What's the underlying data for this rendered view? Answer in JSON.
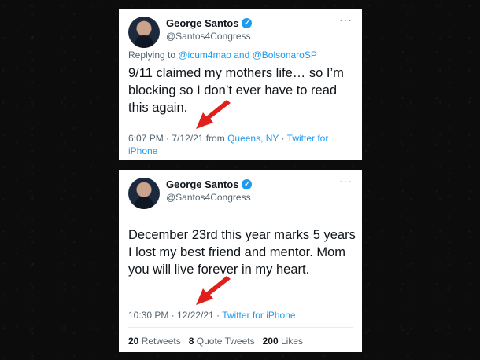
{
  "tweets": [
    {
      "name": "George Santos",
      "handle": "@Santos4Congress",
      "replying_prefix": "Replying to ",
      "replying_user1": "@icum4mao",
      "replying_and": " and ",
      "replying_user2": "@BolsonaroSP",
      "text": "9/11 claimed my mothers life… so I’m blocking so I don’t ever have to read this again.",
      "time": "6:07 PM · 7/12/21 from ",
      "location": "Queens, NY",
      "sep": " · ",
      "client": "Twitter for iPhone"
    },
    {
      "name": "George Santos",
      "handle": "@Santos4Congress",
      "text": "December 23rd this year marks 5 years I lost my best friend and mentor. Mom you will live forever in my heart.",
      "time": "10:30 PM · 12/22/21 · ",
      "client": "Twitter for iPhone",
      "retweets": "20",
      "retweets_label": "Retweets",
      "quotes": "8",
      "quotes_label": "Quote Tweets",
      "likes": "200",
      "likes_label": "Likes"
    }
  ],
  "icons": {
    "verified": "verified-badge-icon",
    "more": "more-options-icon",
    "arrow": "red-annotation-arrow"
  },
  "colors": {
    "link": "#1d9bf0",
    "arrow": "#e0201a",
    "background": "#0c0c0c"
  }
}
